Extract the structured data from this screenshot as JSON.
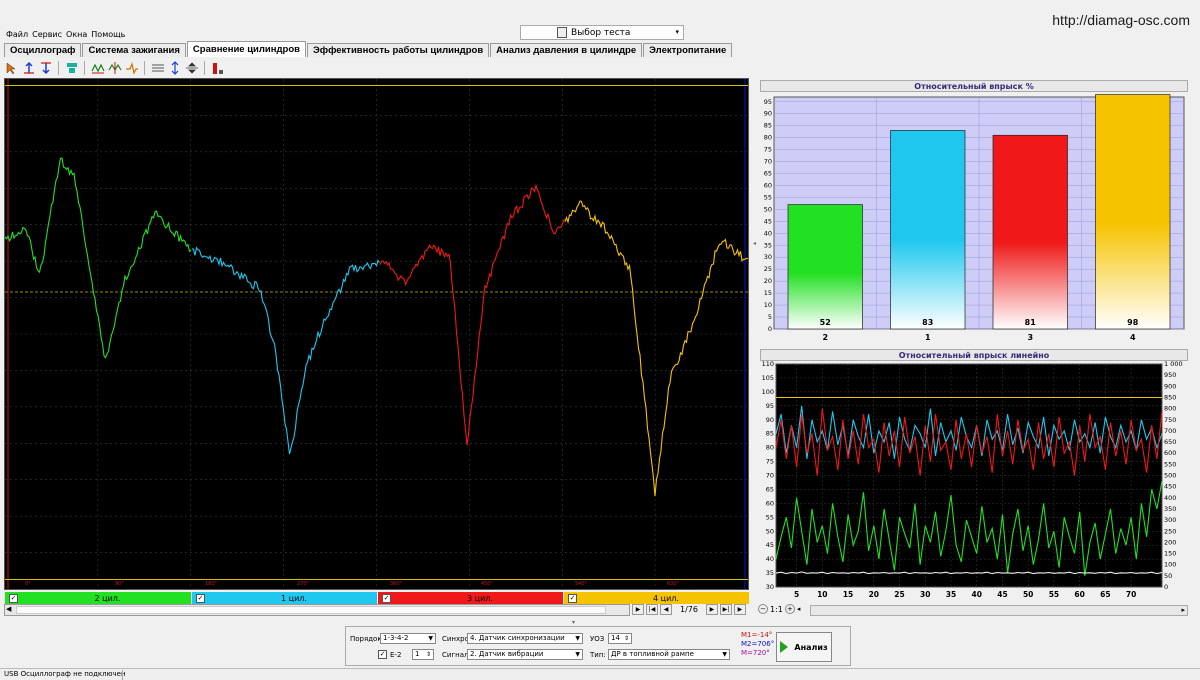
{
  "url": "http://diamag-osc.com",
  "menu": [
    "Файл",
    "Сервис",
    "Окна",
    "Помощь"
  ],
  "test_select": {
    "value": "Выбор теста"
  },
  "tabs": [
    {
      "label": "Осциллограф",
      "active": false
    },
    {
      "label": "Система зажигания",
      "active": false
    },
    {
      "label": "Сравнение цилиндров",
      "active": true
    },
    {
      "label": "Эффективность работы цилиндров",
      "active": false
    },
    {
      "label": "Анализ давления в цилиндре",
      "active": false
    },
    {
      "label": "Электропитание",
      "active": false
    }
  ],
  "toolbar_icons": [
    "cursor-mode-icon",
    "marker-up-icon",
    "marker-down-icon",
    "filter-icon",
    "scale-x-icon",
    "add-marker-icon",
    "phase-icon",
    "hlines-icon",
    "expand-icon",
    "split-icon",
    "bar-icon"
  ],
  "oscillogram": {
    "degrees": [
      "0°",
      "90°",
      "180°",
      "270°",
      "360°",
      "450°",
      "540°",
      "630°"
    ],
    "cylinder_labels": [
      "2 цил.",
      "1 цил.",
      "3 цил.",
      "4 цил."
    ],
    "cylinder_colors": [
      "#22e022",
      "#1ec8ef",
      "#f01818",
      "#f6c300"
    ],
    "nav_page": "1/76"
  },
  "chart_data": [
    {
      "type": "bar",
      "title": "Относительный впрыск %",
      "categories": [
        "2",
        "1",
        "3",
        "4"
      ],
      "values": [
        52,
        83,
        81,
        98
      ],
      "colors": [
        "#22e022",
        "#1ec8ef",
        "#f01818",
        "#f6c300"
      ],
      "ylim": [
        0,
        97
      ],
      "yticks": [
        0,
        5,
        10,
        15,
        20,
        25,
        30,
        35,
        40,
        45,
        50,
        55,
        60,
        65,
        70,
        75,
        80,
        85,
        90,
        95
      ],
      "grid": true
    },
    {
      "type": "line",
      "title": "Относительный впрыск линейно",
      "ylim_left": [
        30,
        110
      ],
      "yticks_left": [
        30,
        35,
        40,
        45,
        50,
        55,
        60,
        65,
        70,
        75,
        80,
        85,
        90,
        95,
        100,
        105,
        110
      ],
      "ylim_right": [
        0,
        1000
      ],
      "yticks_right": [
        "0",
        "50",
        "100",
        "150",
        "200",
        "250",
        "300",
        "350",
        "400",
        "450",
        "500",
        "550",
        "600",
        "650",
        "700",
        "750",
        "800",
        "850",
        "900",
        "950",
        "1 000"
      ],
      "xticks": [
        5,
        10,
        15,
        20,
        25,
        30,
        35,
        40,
        45,
        50,
        55,
        60,
        65,
        70
      ],
      "xlim": [
        1,
        76
      ],
      "grid": true,
      "series": [
        {
          "color": "#f6c300",
          "values": [
            98,
            98,
            98,
            98,
            98,
            98,
            98,
            98,
            98,
            98,
            98,
            98,
            98,
            98,
            98,
            98,
            98,
            98,
            98,
            98,
            98,
            98,
            98,
            98,
            98,
            98,
            98,
            98,
            98,
            98,
            98,
            98,
            98,
            98,
            98,
            98,
            98,
            98,
            98,
            98,
            98,
            98,
            98,
            98,
            98,
            98,
            98,
            98,
            98,
            98,
            98,
            98,
            98,
            98,
            98,
            98,
            98,
            98,
            98,
            98,
            98,
            98,
            98,
            98,
            98,
            98,
            98,
            98,
            98,
            98,
            98,
            98,
            98,
            98,
            98,
            98
          ]
        },
        {
          "color": "#1ec8ef",
          "values": [
            85,
            92,
            78,
            88,
            80,
            95,
            76,
            90,
            82,
            86,
            79,
            93,
            81,
            88,
            77,
            90,
            84,
            80,
            92,
            78,
            86,
            82,
            89,
            76,
            91,
            83,
            79,
            88,
            85,
            80,
            94,
            77,
            89,
            82,
            86,
            79,
            91,
            84,
            80,
            88,
            77,
            90,
            83,
            86,
            79,
            92,
            81,
            87,
            78,
            89,
            84,
            80,
            91,
            77,
            88,
            83,
            86,
            79,
            90,
            82,
            85,
            80,
            89,
            78,
            91,
            84,
            80,
            88,
            82,
            86,
            79,
            90,
            83,
            87,
            80,
            85
          ]
        },
        {
          "color": "#f01818",
          "values": [
            80,
            90,
            76,
            88,
            73,
            92,
            78,
            85,
            70,
            94,
            79,
            84,
            72,
            90,
            76,
            86,
            74,
            92,
            80,
            83,
            71,
            89,
            77,
            86,
            73,
            91,
            78,
            84,
            70,
            88,
            75,
            92,
            79,
            82,
            72,
            90,
            76,
            85,
            73,
            88,
            78,
            84,
            71,
            92,
            77,
            86,
            74,
            90,
            79,
            83,
            72,
            89,
            76,
            85,
            73,
            91,
            78,
            82,
            70,
            88,
            75,
            92,
            80,
            84,
            72,
            89,
            77,
            86,
            74,
            90,
            79,
            83,
            71,
            88,
            76,
            93
          ]
        },
        {
          "color": "#22e022",
          "values": [
            40,
            48,
            55,
            44,
            62,
            50,
            38,
            58,
            46,
            52,
            42,
            60,
            48,
            39,
            56,
            45,
            50,
            64,
            43,
            52,
            40,
            58,
            47,
            36,
            55,
            49,
            44,
            60,
            38,
            52,
            46,
            57,
            41,
            50,
            63,
            45,
            39,
            54,
            48,
            42,
            59,
            46,
            51,
            40,
            56,
            35,
            49,
            58,
            43,
            52,
            38,
            47,
            60,
            44,
            50,
            37,
            55,
            48,
            42,
            57,
            34,
            46,
            53,
            40,
            49,
            58,
            42,
            51,
            45,
            55,
            40,
            60,
            48,
            65,
            58,
            68
          ]
        },
        {
          "color": "#eeeeee",
          "values": [
            35,
            35.3,
            34.8,
            35.2,
            35,
            35.4,
            34.9,
            35.1,
            35,
            35.3,
            34.8,
            35.2,
            35,
            35.1,
            34.9,
            35.2,
            35,
            35.3,
            34.8,
            35.1,
            35,
            35.2,
            34.9,
            35.1,
            35,
            35.3,
            34.8,
            35.2,
            35,
            35.1,
            34.9,
            35.2,
            35,
            35.3,
            34.8,
            35.1,
            35,
            35.2,
            34.9,
            35.1,
            35,
            35.3,
            34.8,
            35.2,
            35,
            35.1,
            34.9,
            35.2,
            35,
            35.3,
            34.8,
            35.1,
            35,
            35.2,
            34.9,
            35.1,
            35,
            35.3,
            34.8,
            35.2,
            35,
            35.1,
            34.9,
            35.2,
            35,
            35.3,
            34.8,
            35.1,
            35,
            35.2,
            34.9,
            35.1,
            35,
            35.3,
            34.8,
            35.2
          ]
        }
      ]
    }
  ],
  "zoom": {
    "ratio": "1:1"
  },
  "controls": {
    "order_label": "Порядок",
    "order_value": "1-3-4-2",
    "e2_label": "E-2",
    "e2_checked": true,
    "e2_value": "1",
    "sync_label": "Синхро:",
    "sync_value": "4. Датчик синхронизации",
    "signal_label": "Сигнал:",
    "signal_value": "2. Датчик вибрации",
    "uoz_label": "УОЗ",
    "uoz_value": "14",
    "type_label": "Тип:",
    "type_value": "ДР в топливной рампе",
    "markers": [
      {
        "text": "M1=-14°",
        "color": "#d01010"
      },
      {
        "text": "M2=706°",
        "color": "#1010d0"
      },
      {
        "text": "M=720°",
        "color": "#a010a0"
      }
    ],
    "analyze_label": "Анализ"
  },
  "status": "USB Осциллограф не подключен"
}
